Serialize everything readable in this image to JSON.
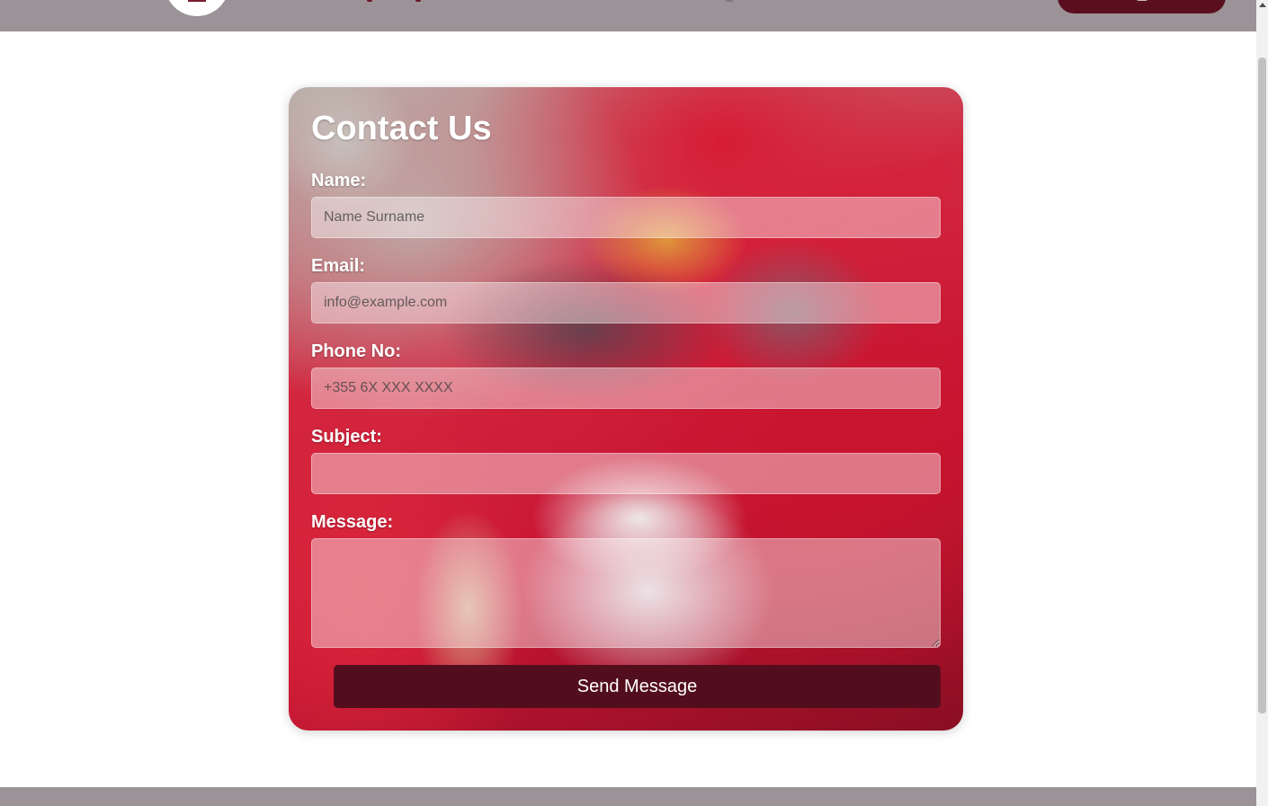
{
  "form": {
    "title": "Contact Us",
    "fields": [
      {
        "label": "Name:",
        "placeholder": "Name Surname",
        "value": ""
      },
      {
        "label": "Email:",
        "placeholder": "info@example.com",
        "value": ""
      },
      {
        "label": "Phone No:",
        "placeholder": "+355 6X XXX XXXX",
        "value": ""
      },
      {
        "label": "Subject:",
        "placeholder": "",
        "value": ""
      }
    ],
    "message": {
      "label": "Message:",
      "placeholder": "",
      "value": ""
    },
    "submit_label": "Send Message",
    "background_image": "cat-in-red-blanket-photo"
  },
  "colors": {
    "header_bar": "#9b9397",
    "footer_bar": "#9b9397",
    "button_bg": "#530e1e",
    "nav_button_bg": "#5a0f1f",
    "page_bg": "#ffffff"
  }
}
